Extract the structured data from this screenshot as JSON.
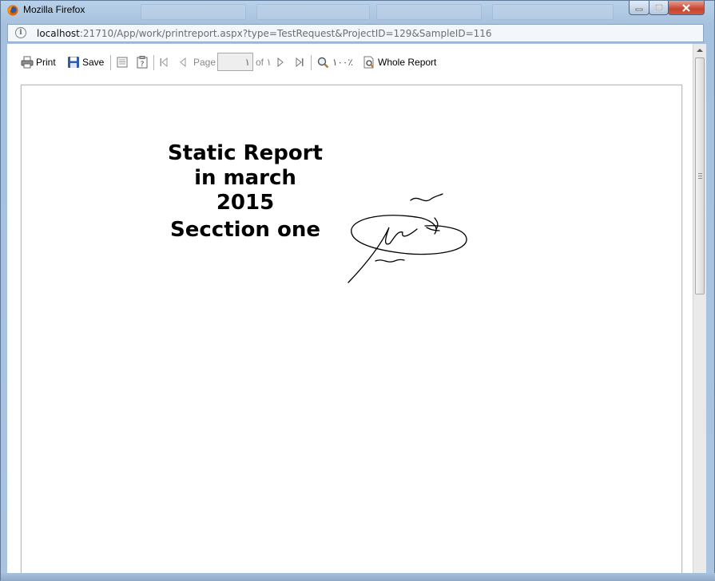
{
  "window": {
    "title": "Mozilla Firefox"
  },
  "urlbar": {
    "host": "localhost",
    "path": ":21710/App/work/printreport.aspx?type=TestRequest&ProjectID=129&SampleID=116"
  },
  "toolbar": {
    "print_label": "Print",
    "save_label": "Save",
    "page_label": "Page",
    "page_value": "١",
    "of_label": "of ١",
    "zoom_value": "١٠٠٪",
    "whole_report_label": "Whole Report"
  },
  "report": {
    "title_lines": [
      "Static Report",
      "in march",
      "2015",
      "Secction one"
    ]
  },
  "colors": {
    "titlebar": "#a6c1de",
    "close_button": "#c7452f",
    "save_icon": "#2d5da8"
  }
}
